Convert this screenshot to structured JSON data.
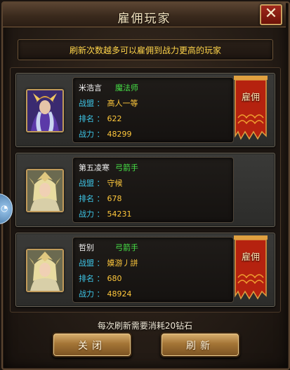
{
  "dialog": {
    "title": "雇佣玩家",
    "close_icon": "close-icon"
  },
  "notice": "刷新次数越多可以雇佣到战力更高的玩家",
  "labels": {
    "alliance": "战盟",
    "rank": "排名",
    "power": "战力",
    "colon": "："
  },
  "players": [
    {
      "name": "米浩言",
      "class": "魔法师",
      "alliance": "高人一等",
      "rank": "622",
      "power": "48299",
      "hire_label": "雇佣",
      "hire_available": true
    },
    {
      "name": "第五凌寒",
      "class": "弓箭手",
      "alliance": "守候",
      "rank": "678",
      "power": "54231",
      "hire_label": "",
      "hire_available": false
    },
    {
      "name": "哲别",
      "class": "弓箭手",
      "alliance": "嫫游丿誁",
      "rank": "680",
      "power": "48924",
      "hire_label": "雇佣",
      "hire_available": true
    }
  ],
  "footer": "每次刷新需要消耗20钻石",
  "buttons": {
    "close": "关闭",
    "refresh": "刷新"
  },
  "colors": {
    "class_text": "#46e046",
    "label_text": "#3ec6e8",
    "value_text": "#ffc83c",
    "notice_text": "#ffd54a",
    "hire_banner": "#b5220f"
  }
}
